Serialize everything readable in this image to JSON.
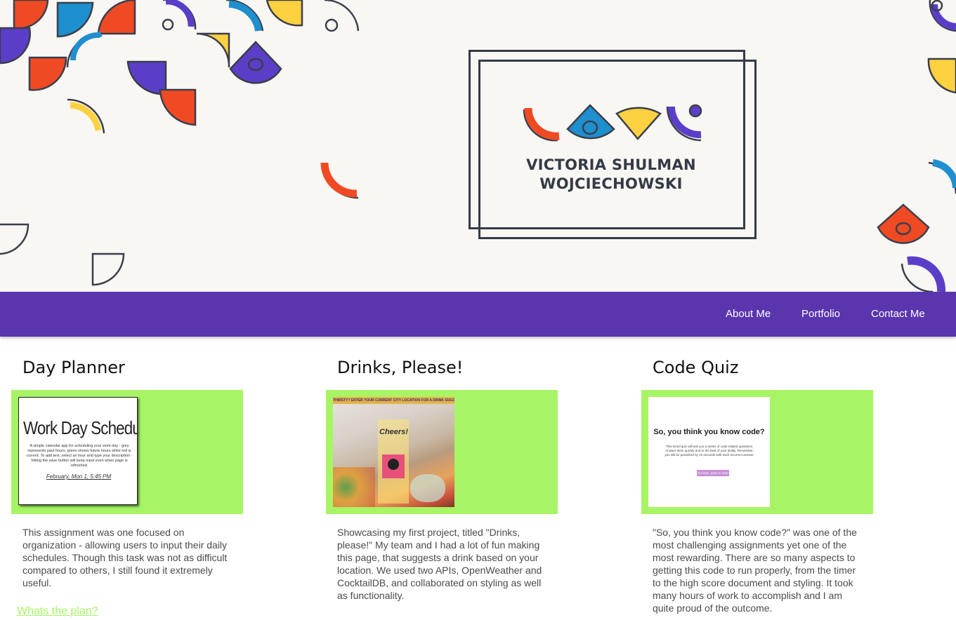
{
  "hero": {
    "logo_line1": "VICTORIA SHULMAN",
    "logo_line2": "WOJCIECHOWSKI"
  },
  "nav": {
    "items": [
      {
        "label": "About Me"
      },
      {
        "label": "Portfolio"
      },
      {
        "label": "Contact Me"
      }
    ]
  },
  "projects": [
    {
      "title": "Day Planner",
      "description": "This assignment was one focused on organization - allowing users to input their daily schedules. Though this task was not as difficult compared to others, I still found it extremely useful.",
      "link": "Whats the plan?",
      "thumb": {
        "heading": "Work Day Scheduler",
        "subtext": "A simple calendar app for scheduling your work day - grey represents past hours, green shows future hours while red is current. To add text, select an hour and type your description - hitting the save button will keep input even when page is refreshed.",
        "date": "February, Mon 1, 5:45 PM"
      }
    },
    {
      "title": "Drinks, Please!",
      "description": "Showcasing my first project, titled \"Drinks, please!\" My team and I had a lot of fun making this page, that suggests a drink based on your location. We used two APIs, OpenWeather and CocktailDB, and collaborated on styling as well as functionality.",
      "link": "",
      "thumb": {
        "banner": "THIRSTY? ENTER YOUR CURRENT CITY LOCATION FOR A DRINK SUGGESTION!",
        "cheers": "Cheers!"
      }
    },
    {
      "title": "Code Quiz",
      "description": "\"So, you think you know code?\" was one of the most challenging assignments yet one of the most rewarding. There are so many aspects to getting this code to run properly, from the timer to the high score document and styling. It took many hours of work to accomplish and I am quite proud of the outcome.",
      "link": "",
      "thumb": {
        "heading": "So, you think you know code?",
        "body": "This timed quiz will ask you a series of code related questions. Answer them quickly and to the best of your ability. Remember, you will be penalized by 10 seconds with each incorrect answer.",
        "button": "No keys, push to start"
      }
    }
  ],
  "colors": {
    "nav_bg": "#5a35ae",
    "card_bg": "#a7f565",
    "hero_bg": "#f9f7f4",
    "accent_red": "#f04a24",
    "accent_blue": "#1e8fcf",
    "accent_yellow": "#fdd13f",
    "accent_purple": "#5b3ec8"
  }
}
